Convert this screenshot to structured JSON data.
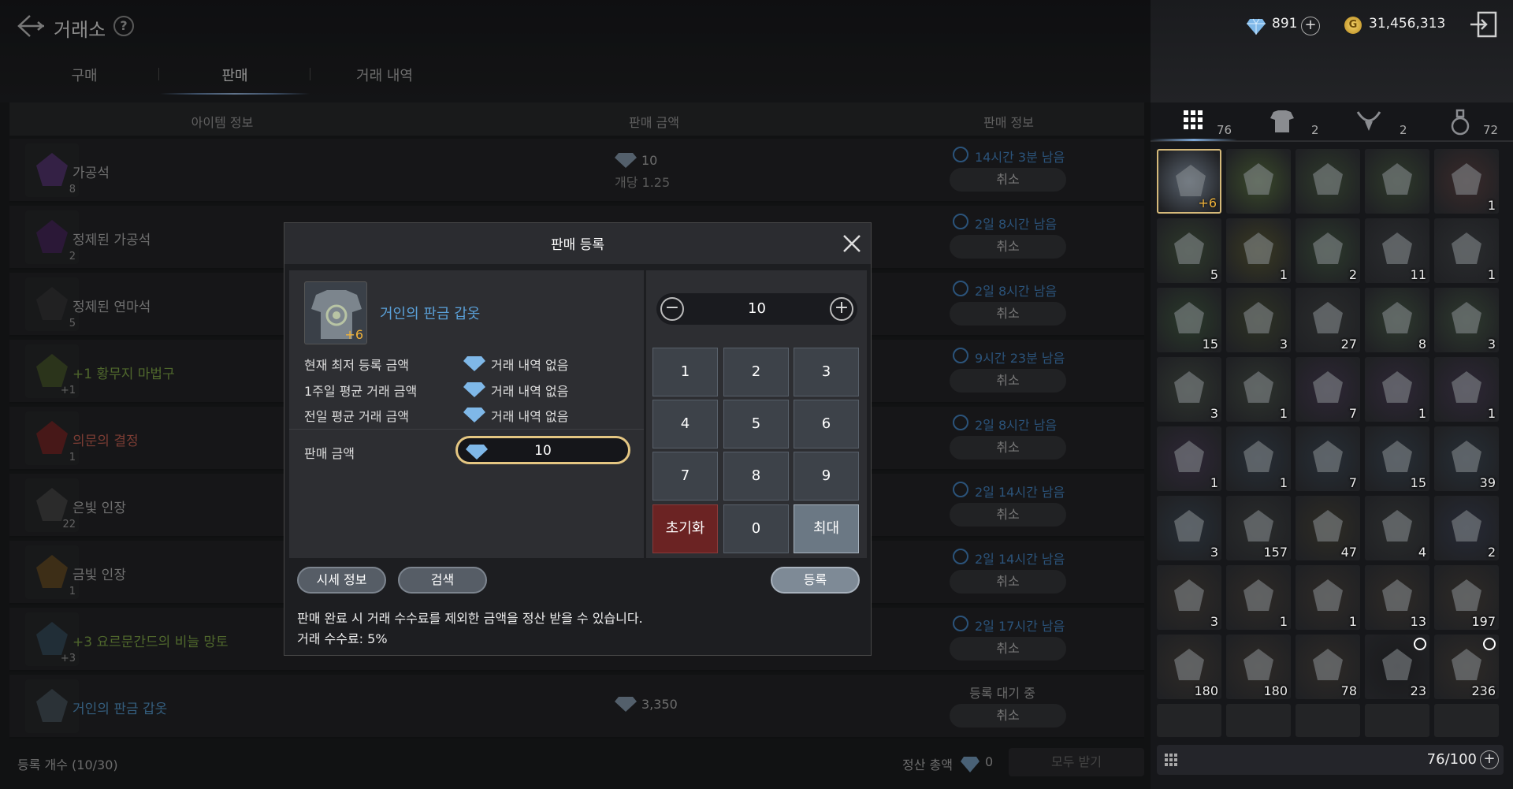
{
  "header": {
    "title": "거래소",
    "help": "?",
    "diamonds": "891",
    "gold_icon": "G",
    "gold": "31,456,313"
  },
  "tabs": [
    "구매",
    "판매",
    "거래 내역"
  ],
  "columns": [
    "아이템 정보",
    "판매 금액",
    "판매 정보"
  ],
  "rows": [
    {
      "name": "가공석",
      "count": "8",
      "price": "10",
      "unit": "개당 1.25",
      "time": "14시간 3분 남음",
      "cancel": "취소"
    },
    {
      "name": "정제된 가공석",
      "count": "2",
      "time": "2일 8시간 남음",
      "cancel": "취소"
    },
    {
      "name": "정제된 연마석",
      "count": "5",
      "time": "2일 8시간 남음",
      "cancel": "취소"
    },
    {
      "name": "+1 황무지 마법구",
      "count": "+1",
      "time": "9시간 23분 남음",
      "cancel": "취소"
    },
    {
      "name": "의문의 결정",
      "count": "1",
      "time": "2일 8시간 남음",
      "cancel": "취소"
    },
    {
      "name": "은빛 인장",
      "count": "22",
      "time": "2일 14시간 남음",
      "cancel": "취소"
    },
    {
      "name": "금빛 인장",
      "count": "1",
      "time": "2일 14시간 남음",
      "cancel": "취소"
    },
    {
      "name": "+3 요르문간드의 비늘 망토",
      "count": "+3",
      "time": "2일 17시간 남음",
      "cancel": "취소"
    },
    {
      "name": "거인의 판금 갑옷",
      "price": "3,350",
      "status": "등록 대기 중",
      "cancel": "취소"
    }
  ],
  "footer": {
    "reg_count": "등록 개수 (10/30)",
    "settle_label": "정산 총액",
    "settle_value": "0",
    "receive_all": "모두 받기"
  },
  "modal": {
    "title": "판매 등록",
    "item_name": "거인의 판금 갑옷",
    "item_enh": "+6",
    "lowest_label": "현재 최저 등록 금액",
    "lowest_value": "거래 내역 없음",
    "week_label": "1주일 평균 거래 금액",
    "week_value": "거래 내역 없음",
    "prev_label": "전일 평균 거래 금액",
    "prev_value": "거래 내역 없음",
    "price_label": "판매 금액",
    "price_value": "10",
    "quantity": "10",
    "keys": [
      "1",
      "2",
      "3",
      "4",
      "5",
      "6",
      "7",
      "8",
      "9"
    ],
    "reset": "초기화",
    "zero": "0",
    "max": "최대",
    "market_btn": "시세 정보",
    "search_btn": "검색",
    "register_btn": "등록",
    "note": "판매 완료 시 거래 수수료를 제외한 금액을 정산 받을 수 있습니다.",
    "fee": "거래 수수료: 5%"
  },
  "inventory": {
    "tab_counts": [
      "76",
      "2",
      "2",
      "72"
    ],
    "capacity": "76/100",
    "slots": [
      {
        "icon": "plate-armor",
        "label": "+6",
        "color": "#5a6470"
      },
      {
        "icon": "sword",
        "label": "",
        "color": "#3a4a2a"
      },
      {
        "icon": "orb-gauntlet",
        "label": "",
        "color": "#2e3a2a"
      },
      {
        "icon": "orb-gauntlet",
        "label": "",
        "color": "#2e3a2a"
      },
      {
        "icon": "red-crystal",
        "label": "1",
        "color": "#3a2a2a"
      },
      {
        "icon": "ore",
        "label": "5",
        "color": "#2e3a2a"
      },
      {
        "icon": "amber-stone",
        "label": "1",
        "color": "#3a3a22"
      },
      {
        "icon": "green-emblem",
        "label": "2",
        "color": "#2c3a2c"
      },
      {
        "icon": "armor-core",
        "label": "11",
        "color": "#2a2c2e"
      },
      {
        "icon": "rune-stone",
        "label": "1",
        "color": "#2a2c2e"
      },
      {
        "icon": "herb",
        "label": "15",
        "color": "#2a3a2a"
      },
      {
        "icon": "wood",
        "label": "3",
        "color": "#2e3324"
      },
      {
        "icon": "iron-ore",
        "label": "27",
        "color": "#2a2c2c"
      },
      {
        "icon": "silver-emblem",
        "label": "8",
        "color": "#2e3a2e"
      },
      {
        "icon": "silver-emblem",
        "label": "3",
        "color": "#2e3a2e"
      },
      {
        "icon": "seal-rune",
        "label": "3",
        "color": "#2e342e"
      },
      {
        "icon": "seal-rune",
        "label": "1",
        "color": "#2e342e"
      },
      {
        "icon": "purple-essence",
        "label": "7",
        "color": "#2e2636"
      },
      {
        "icon": "scroll-axe",
        "label": "1",
        "color": "#2e2636"
      },
      {
        "icon": "scroll-helm",
        "label": "1",
        "color": "#2e2636"
      },
      {
        "icon": "scroll-mask",
        "label": "1",
        "color": "#2e2636"
      },
      {
        "icon": "blue-ore",
        "label": "1",
        "color": "#262e36"
      },
      {
        "icon": "blue-ore",
        "label": "7",
        "color": "#262e36"
      },
      {
        "icon": "red-potion",
        "label": "15",
        "color": "#262e36"
      },
      {
        "icon": "red-potion",
        "label": "39",
        "color": "#262e36"
      },
      {
        "icon": "scroll",
        "label": "3",
        "color": "#262e36"
      },
      {
        "icon": "stone",
        "label": "157",
        "color": "#2a2c2c"
      },
      {
        "icon": "amber-stone",
        "label": "47",
        "color": "#2e2c24"
      },
      {
        "icon": "tablet-2",
        "label": "4",
        "color": "#2a2c2c"
      },
      {
        "icon": "tablet-3",
        "label": "2",
        "color": "#262a36"
      },
      {
        "icon": "bone-claw",
        "label": "3",
        "color": "#2e2a26"
      },
      {
        "icon": "bone-claw",
        "label": "1",
        "color": "#2e2a26"
      },
      {
        "icon": "bone-claw",
        "label": "1",
        "color": "#2e2a26"
      },
      {
        "icon": "orange-potion",
        "label": "13",
        "color": "#2e2a26"
      },
      {
        "icon": "parchment",
        "label": "197",
        "color": "#2e2a26"
      },
      {
        "icon": "parchment-sword",
        "label": "180",
        "color": "#2e2a26"
      },
      {
        "icon": "parchment-shield",
        "label": "180",
        "color": "#2e2a26"
      },
      {
        "icon": "parchment-rune",
        "label": "78",
        "color": "#2e2a26"
      },
      {
        "icon": "dark-shard",
        "label": "23",
        "color": "#1a1a1c"
      },
      {
        "icon": "parchment-scroll",
        "label": "236",
        "color": "#2e2a26"
      }
    ]
  }
}
